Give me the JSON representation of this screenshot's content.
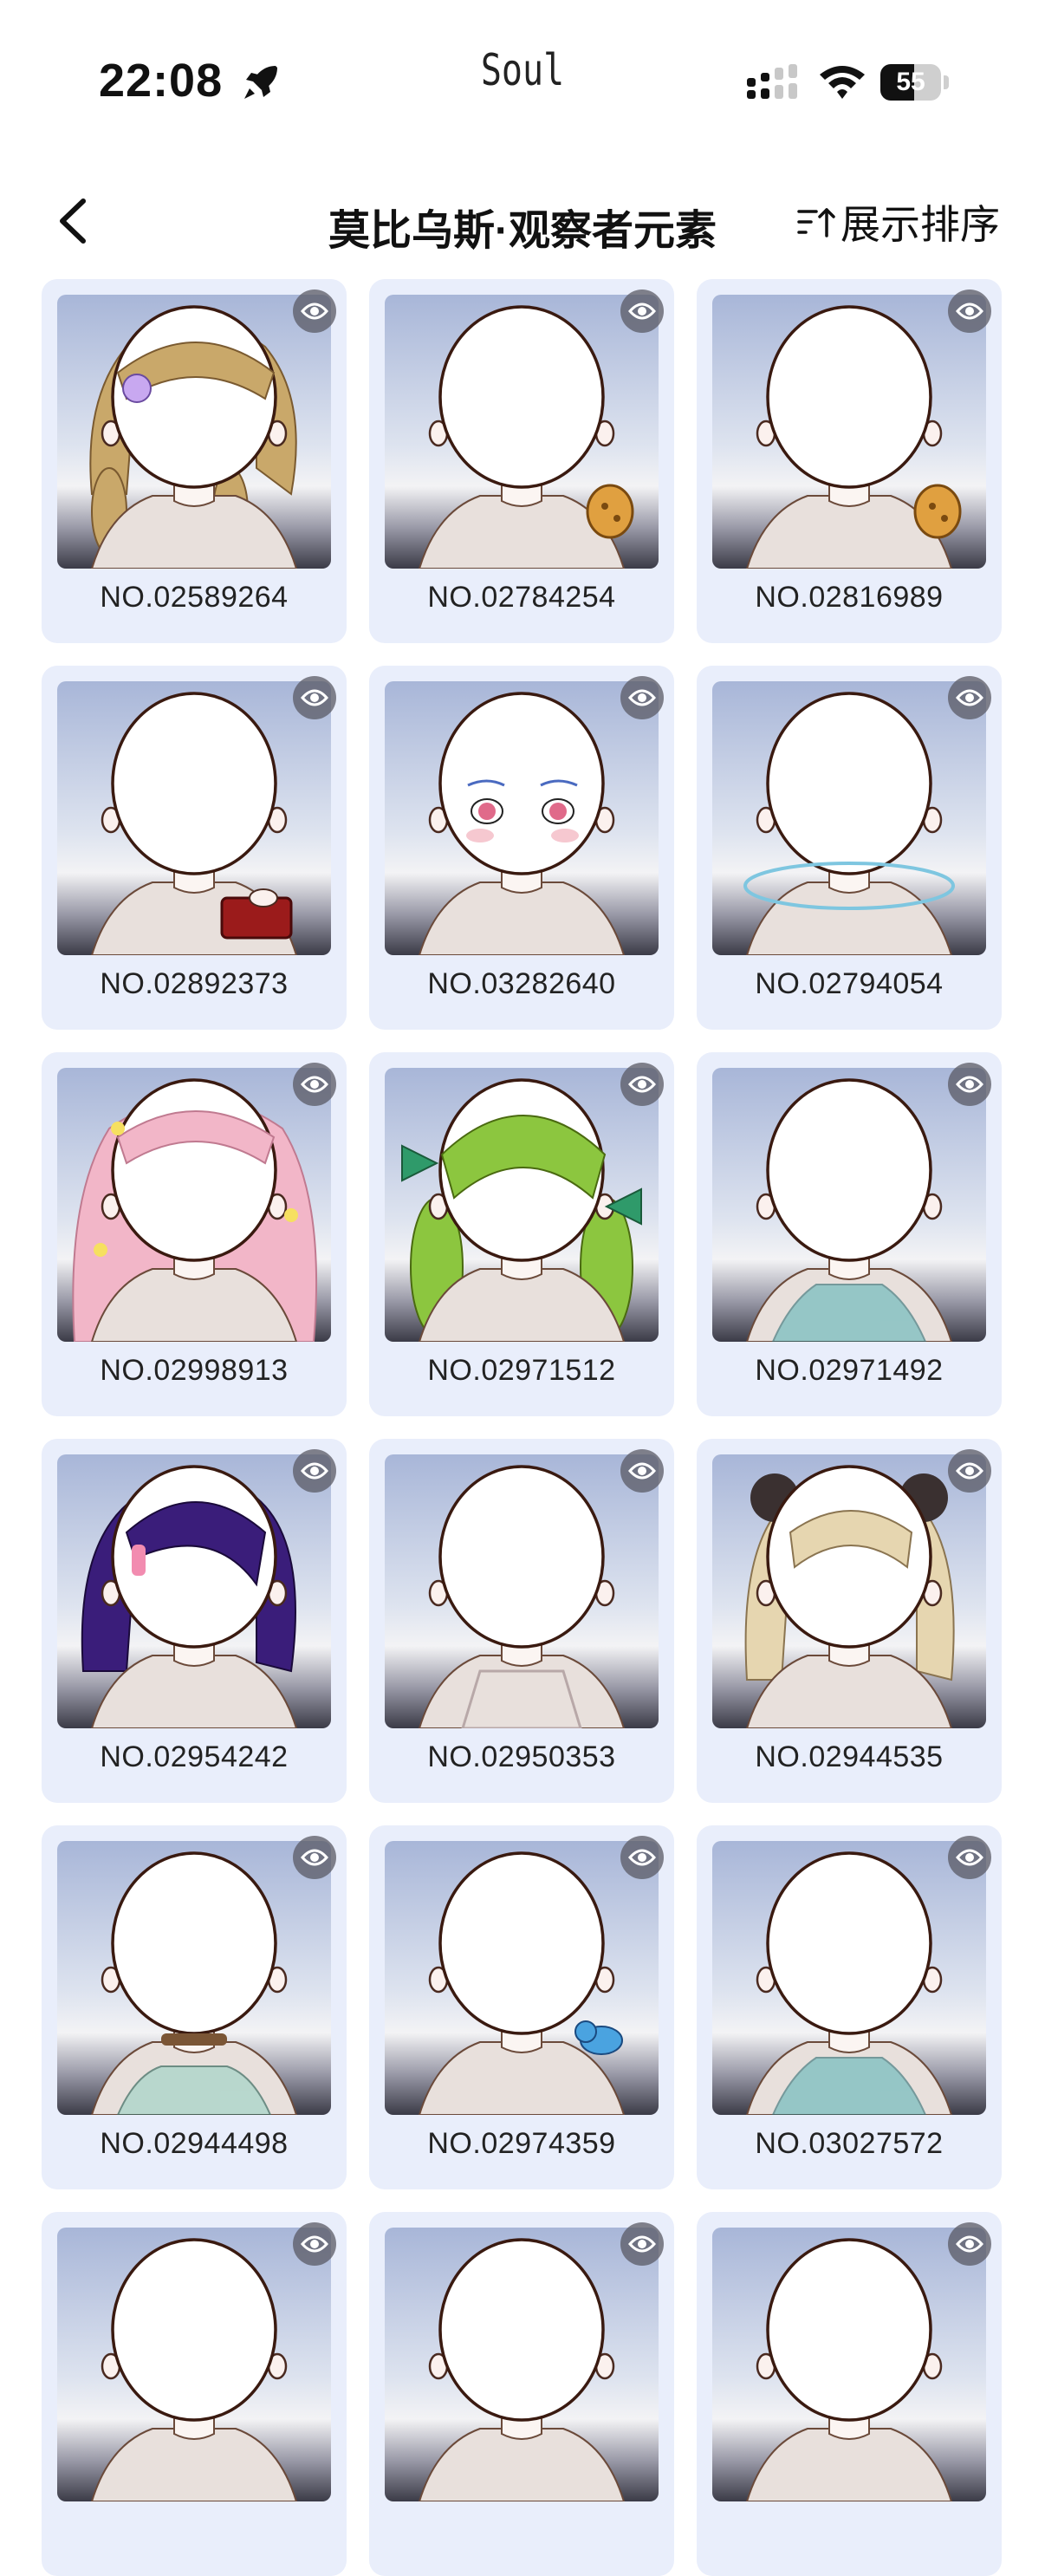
{
  "status_bar": {
    "time": "22:08",
    "carrier": "Soul",
    "battery": "55",
    "battery_level": 0.55,
    "icons": [
      "rocket-icon",
      "signal-icon",
      "wifi-icon",
      "battery-icon"
    ]
  },
  "nav": {
    "title": "莫比乌斯·观察者元素",
    "sort_label": "展示排序",
    "back_icon": "chevron-left-icon",
    "sort_icon": "sort-ascending-icon"
  },
  "colors": {
    "card_bg": "#e9eefb",
    "text": "#222222"
  },
  "items": [
    {
      "code": "NO.02589264",
      "feature": "blonde-braids",
      "accent": "#c9a86a"
    },
    {
      "code": "NO.02784254",
      "feature": "cookie",
      "accent": "#e0a040"
    },
    {
      "code": "NO.02816989",
      "feature": "cookie",
      "accent": "#e0a040"
    },
    {
      "code": "NO.02892373",
      "feature": "red-purse",
      "accent": "#9b1b1b"
    },
    {
      "code": "NO.03282640",
      "feature": "makeup",
      "accent": "#e06a8a"
    },
    {
      "code": "NO.02794054",
      "feature": "halo-ring",
      "accent": "#7ec6e0"
    },
    {
      "code": "NO.02998913",
      "feature": "pink-curls",
      "accent": "#f2b6c8"
    },
    {
      "code": "NO.02971512",
      "feature": "green-braids",
      "accent": "#8cc63f"
    },
    {
      "code": "NO.02971492",
      "feature": "teal-top",
      "accent": "#5fb5b8"
    },
    {
      "code": "NO.02954242",
      "feature": "purple-bob",
      "accent": "#3a1d7a"
    },
    {
      "code": "NO.02950353",
      "feature": "lace-top",
      "accent": "#b8a8a8"
    },
    {
      "code": "NO.02944535",
      "feature": "beige-bob-ears",
      "accent": "#e6d6b0"
    },
    {
      "code": "NO.02944498",
      "feature": "collar-top",
      "accent": "#7a5535"
    },
    {
      "code": "NO.02974359",
      "feature": "blue-bird",
      "accent": "#4aa3e0"
    },
    {
      "code": "NO.03027572",
      "feature": "teal-top",
      "accent": "#5fb5b8"
    },
    {
      "code": "",
      "feature": "none",
      "accent": "#cccccc"
    },
    {
      "code": "",
      "feature": "none",
      "accent": "#cccccc"
    },
    {
      "code": "",
      "feature": "none",
      "accent": "#cccccc"
    }
  ]
}
